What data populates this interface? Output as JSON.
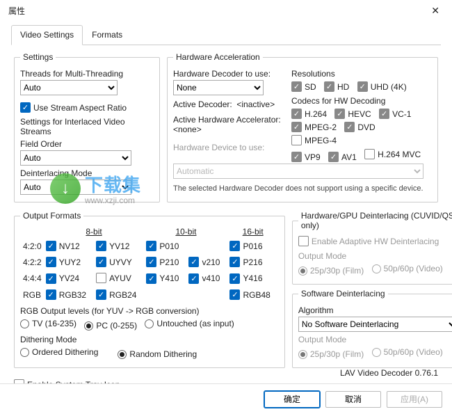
{
  "window": {
    "title": "属性"
  },
  "tabs": {
    "video": "Video Settings",
    "formats": "Formats"
  },
  "settings": {
    "legend": "Settings",
    "threads_label": "Threads for Multi-Threading",
    "threads_value": "Auto",
    "use_aspect": "Use Stream Aspect Ratio",
    "interlaced_label": "Settings for Interlaced Video Streams",
    "field_order_label": "Field Order",
    "field_order_value": "Auto",
    "deint_mode_label": "Deinterlacing Mode",
    "deint_mode_value": "Auto"
  },
  "hw": {
    "legend": "Hardware Acceleration",
    "decoder_label": "Hardware Decoder to use:",
    "decoder_value": "None",
    "active_decoder_label": "Active Decoder:",
    "active_decoder_value": "<inactive>",
    "active_accel_label": "Active Hardware Accelerator:",
    "active_accel_value": "<none>",
    "device_label": "Hardware Device to use:",
    "device_value": "Automatic",
    "res_label": "Resolutions",
    "res": [
      "SD",
      "HD",
      "UHD (4K)"
    ],
    "codecs_label": "Codecs for HW Decoding",
    "codecs": {
      "h264": "H.264",
      "hevc": "HEVC",
      "vc1": "VC-1",
      "mpeg2": "MPEG-2",
      "dvd": "DVD",
      "mpeg4": "MPEG-4",
      "vp9": "VP9",
      "av1": "AV1",
      "h264mvc": "H.264 MVC"
    },
    "note": "The selected Hardware Decoder does not support using a specific device."
  },
  "fmt": {
    "legend": "Output Formats",
    "hdr8": "8-bit",
    "hdr10": "10-bit",
    "hdr16": "16-bit",
    "r1": "4:2:0",
    "r2": "4:2:2",
    "r3": "4:4:4",
    "r4": "RGB",
    "nv12": "NV12",
    "yv12": "YV12",
    "p010": "P010",
    "p016": "P016",
    "yuy2": "YUY2",
    "uyvy": "UYVY",
    "p210": "P210",
    "v210": "v210",
    "p216": "P216",
    "yv24": "YV24",
    "ayuv": "AYUV",
    "y410": "Y410",
    "v410": "v410",
    "y416": "Y416",
    "rgb32": "RGB32",
    "rgb24": "RGB24",
    "rgb48": "RGB48",
    "rgb_levels_label": "RGB Output levels (for YUV -> RGB conversion)",
    "tv": "TV (16-235)",
    "pc": "PC (0-255)",
    "untouched": "Untouched (as input)",
    "dith_label": "Dithering Mode",
    "ordered": "Ordered Dithering",
    "random": "Random Dithering"
  },
  "gpu": {
    "legend": "Hardware/GPU Deinterlacing (CUVID/QS only)",
    "enable": "Enable Adaptive HW Deinterlacing",
    "out_label": "Output Mode",
    "f25": "25p/30p (Film)",
    "v50": "50p/60p (Video)"
  },
  "sw": {
    "legend": "Software Deinterlacing",
    "alg_label": "Algorithm",
    "alg_value": "No Software Deinterlacing",
    "out_label": "Output Mode",
    "f25": "25p/30p (Film)",
    "v50": "50p/60p (Video)"
  },
  "tray": "Enable System Tray Icon",
  "version": "LAV Video Decoder 0.76.1",
  "buttons": {
    "ok": "确定",
    "cancel": "取消",
    "apply": "应用(A)"
  },
  "wm": {
    "big": "下载集",
    "url": "www.xzji.com"
  }
}
